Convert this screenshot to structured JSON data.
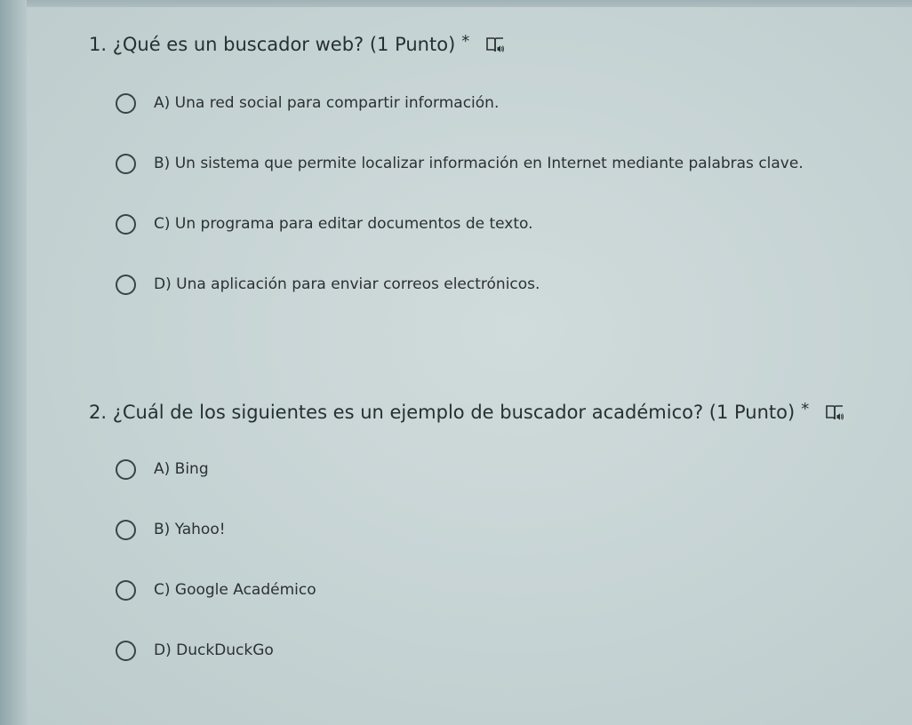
{
  "questions": [
    {
      "title": "1. ¿Qué es un buscador web? (1 Punto)",
      "required_mark": "*",
      "icon": "immersive-reader-icon",
      "options": [
        "A) Una red social para compartir información.",
        "B) Un sistema que permite localizar información en Internet mediante palabras clave.",
        "C) Un programa para editar documentos de texto.",
        "D) Una aplicación para enviar correos electrónicos."
      ]
    },
    {
      "title": "2. ¿Cuál de los siguientes es un ejemplo de buscador académico? (1 Punto)",
      "required_mark": "*",
      "icon": "immersive-reader-icon",
      "options": [
        "A) Bing",
        "B) Yahoo!",
        "C) Google Académico",
        "D) DuckDuckGo"
      ]
    }
  ]
}
